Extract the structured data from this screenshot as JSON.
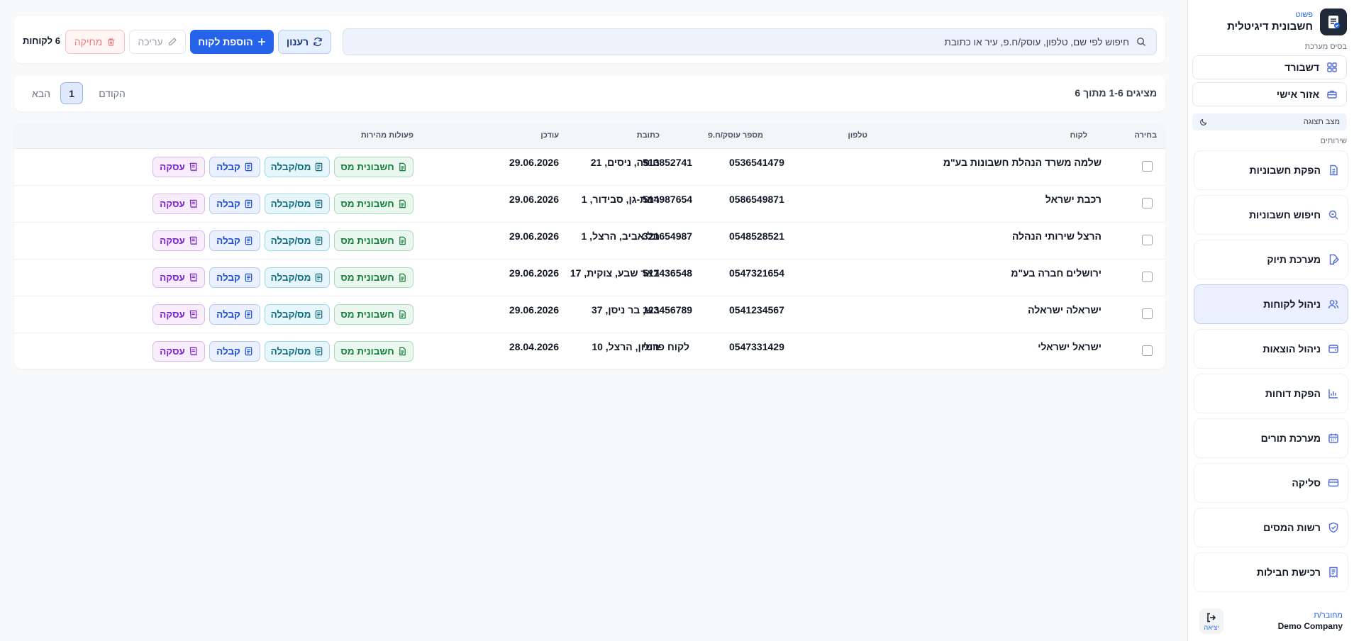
{
  "brand": {
    "subtitle": "פשוט",
    "title": "חשבונית דיגיטלית"
  },
  "sidebar": {
    "system_label": "בסיס מערכת",
    "system_items": [
      {
        "label": "דשבורד",
        "icon": "grid-icon"
      },
      {
        "label": "אזור אישי",
        "icon": "briefcase-icon"
      }
    ],
    "theme_label": "מצב תצוגה",
    "services_label": "שירותים",
    "services": [
      {
        "label": "הפקת חשבוניות",
        "icon": "document-icon"
      },
      {
        "label": "חיפוש חשבוניות",
        "icon": "search-doc-icon"
      },
      {
        "label": "מערכת תיוק",
        "icon": "file-edit-icon"
      },
      {
        "label": "ניהול לקוחות",
        "icon": "users-icon",
        "active": true
      },
      {
        "label": "ניהול הוצאות",
        "icon": "wallet-icon"
      },
      {
        "label": "הפקת דוחות",
        "icon": "bar-chart-icon"
      },
      {
        "label": "מערכת תורים",
        "icon": "calendar-icon"
      },
      {
        "label": "סליקה",
        "icon": "credit-card-icon"
      },
      {
        "label": "רשות המסים",
        "icon": "shield-icon"
      },
      {
        "label": "רכישת חבילות",
        "icon": "receipt-icon"
      }
    ],
    "user_role": "מחובר/ת",
    "user_name": "Demo Company",
    "logout_label": "יציאה"
  },
  "toolbar": {
    "search_placeholder": "חיפוש לפי שם, טלפון, עוסק/ח.פ, עיר או כתובת",
    "refresh_label": "רענון",
    "add_label": "הוספת לקוח",
    "edit_label": "עריכה",
    "delete_label": "מחיקה",
    "count_label": "6 לקוחות"
  },
  "pagination": {
    "showing": "מציגים 1-6 מתוך 6",
    "prev": "הקודם",
    "current": "1",
    "next": "הבא"
  },
  "table": {
    "headers": {
      "select": "בחירה",
      "customer": "לקוח",
      "phone": "טלפון",
      "vat": "מספר עוסק/ח.פ",
      "address": "כתובת",
      "updated": "עודכן",
      "actions": "פעולות מהירות"
    },
    "actions": {
      "tax_invoice": "חשבונית מס",
      "tax_receipt": "מס/קבלה",
      "receipt": "קבלה",
      "deal": "עסקה"
    },
    "rows": [
      {
        "customer": "שלמה משרד הנהלת חשבונות בע\"מ",
        "phone": "0536541479",
        "vat": "513852741",
        "address": "חיפה, ניסים, 21",
        "updated": "29.06.2026"
      },
      {
        "customer": "רכבת ישראל",
        "phone": "0586549871",
        "vat": "514987654",
        "address": "רמת-גן, סבידור, 1",
        "updated": "29.06.2026"
      },
      {
        "customer": "הרצל שירותי הנהלה",
        "phone": "0548528521",
        "vat": "321654987",
        "address": "תל אביב, הרצל, 1",
        "updated": "29.06.2026"
      },
      {
        "customer": "ירושלים חברה בע\"מ",
        "phone": "0547321654",
        "vat": "517436548",
        "address": "באר שבע, צוקית, 17",
        "updated": "29.06.2026"
      },
      {
        "customer": "ישראלה ישראלה",
        "phone": "0541234567",
        "vat": "123456789",
        "address": "בש, בר ניסן, 37",
        "updated": "29.06.2026"
      },
      {
        "customer": "ישראל ישראלי",
        "phone": "0547331429",
        "vat": "לקוח פרטי",
        "address": "חולון, הרצל, 10",
        "updated": "28.04.2026"
      }
    ]
  },
  "colors": {
    "primary": "#2563eb",
    "tax": "#15803d",
    "tax_receipt": "#0e6b80",
    "receipt": "#1d4ed8",
    "deal": "#7e22ce",
    "danger": "#ef7c7c"
  }
}
